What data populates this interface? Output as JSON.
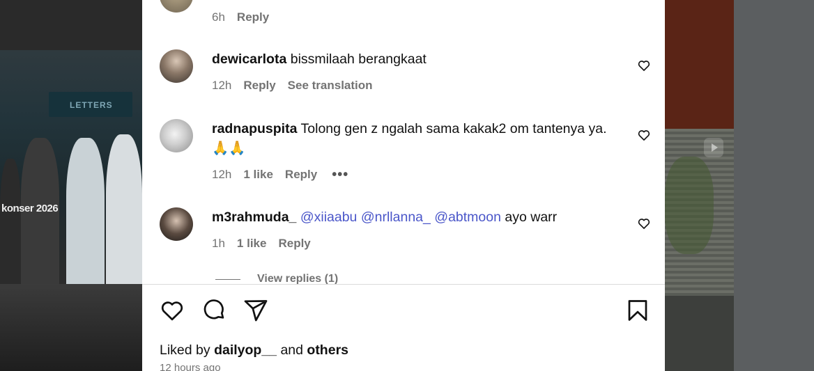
{
  "background": {
    "left_caption": "konser 2026",
    "left_banner": "LETTERS"
  },
  "comments": [
    {
      "meta": {
        "time": "6h",
        "reply": "Reply"
      }
    },
    {
      "username": "dewicarlota",
      "text": "bissmilaah berangkaat",
      "meta": {
        "time": "12h",
        "reply": "Reply",
        "translate": "See translation"
      }
    },
    {
      "username": "radnapuspita",
      "text": "Tolong gen z ngalah sama kakak2 om tantenya ya. 🙏🙏",
      "meta": {
        "time": "12h",
        "likes": "1 like",
        "reply": "Reply",
        "more": "•••"
      }
    },
    {
      "username": "m3rahmuda_",
      "mentions": [
        "@xiiaabu",
        "@nrllanna_",
        "@abtmoon"
      ],
      "text": "ayo warr",
      "meta": {
        "time": "1h",
        "likes": "1 like",
        "reply": "Reply"
      },
      "view_replies": "View replies (1)"
    }
  ],
  "footer": {
    "liked_prefix": "Liked by",
    "liked_user": "dailyop__",
    "liked_and": "and",
    "liked_others": "others",
    "timestamp": "12 hours ago"
  },
  "icons": {
    "like": "heart-icon",
    "comment": "comment-icon",
    "share": "share-icon",
    "save": "bookmark-icon"
  }
}
